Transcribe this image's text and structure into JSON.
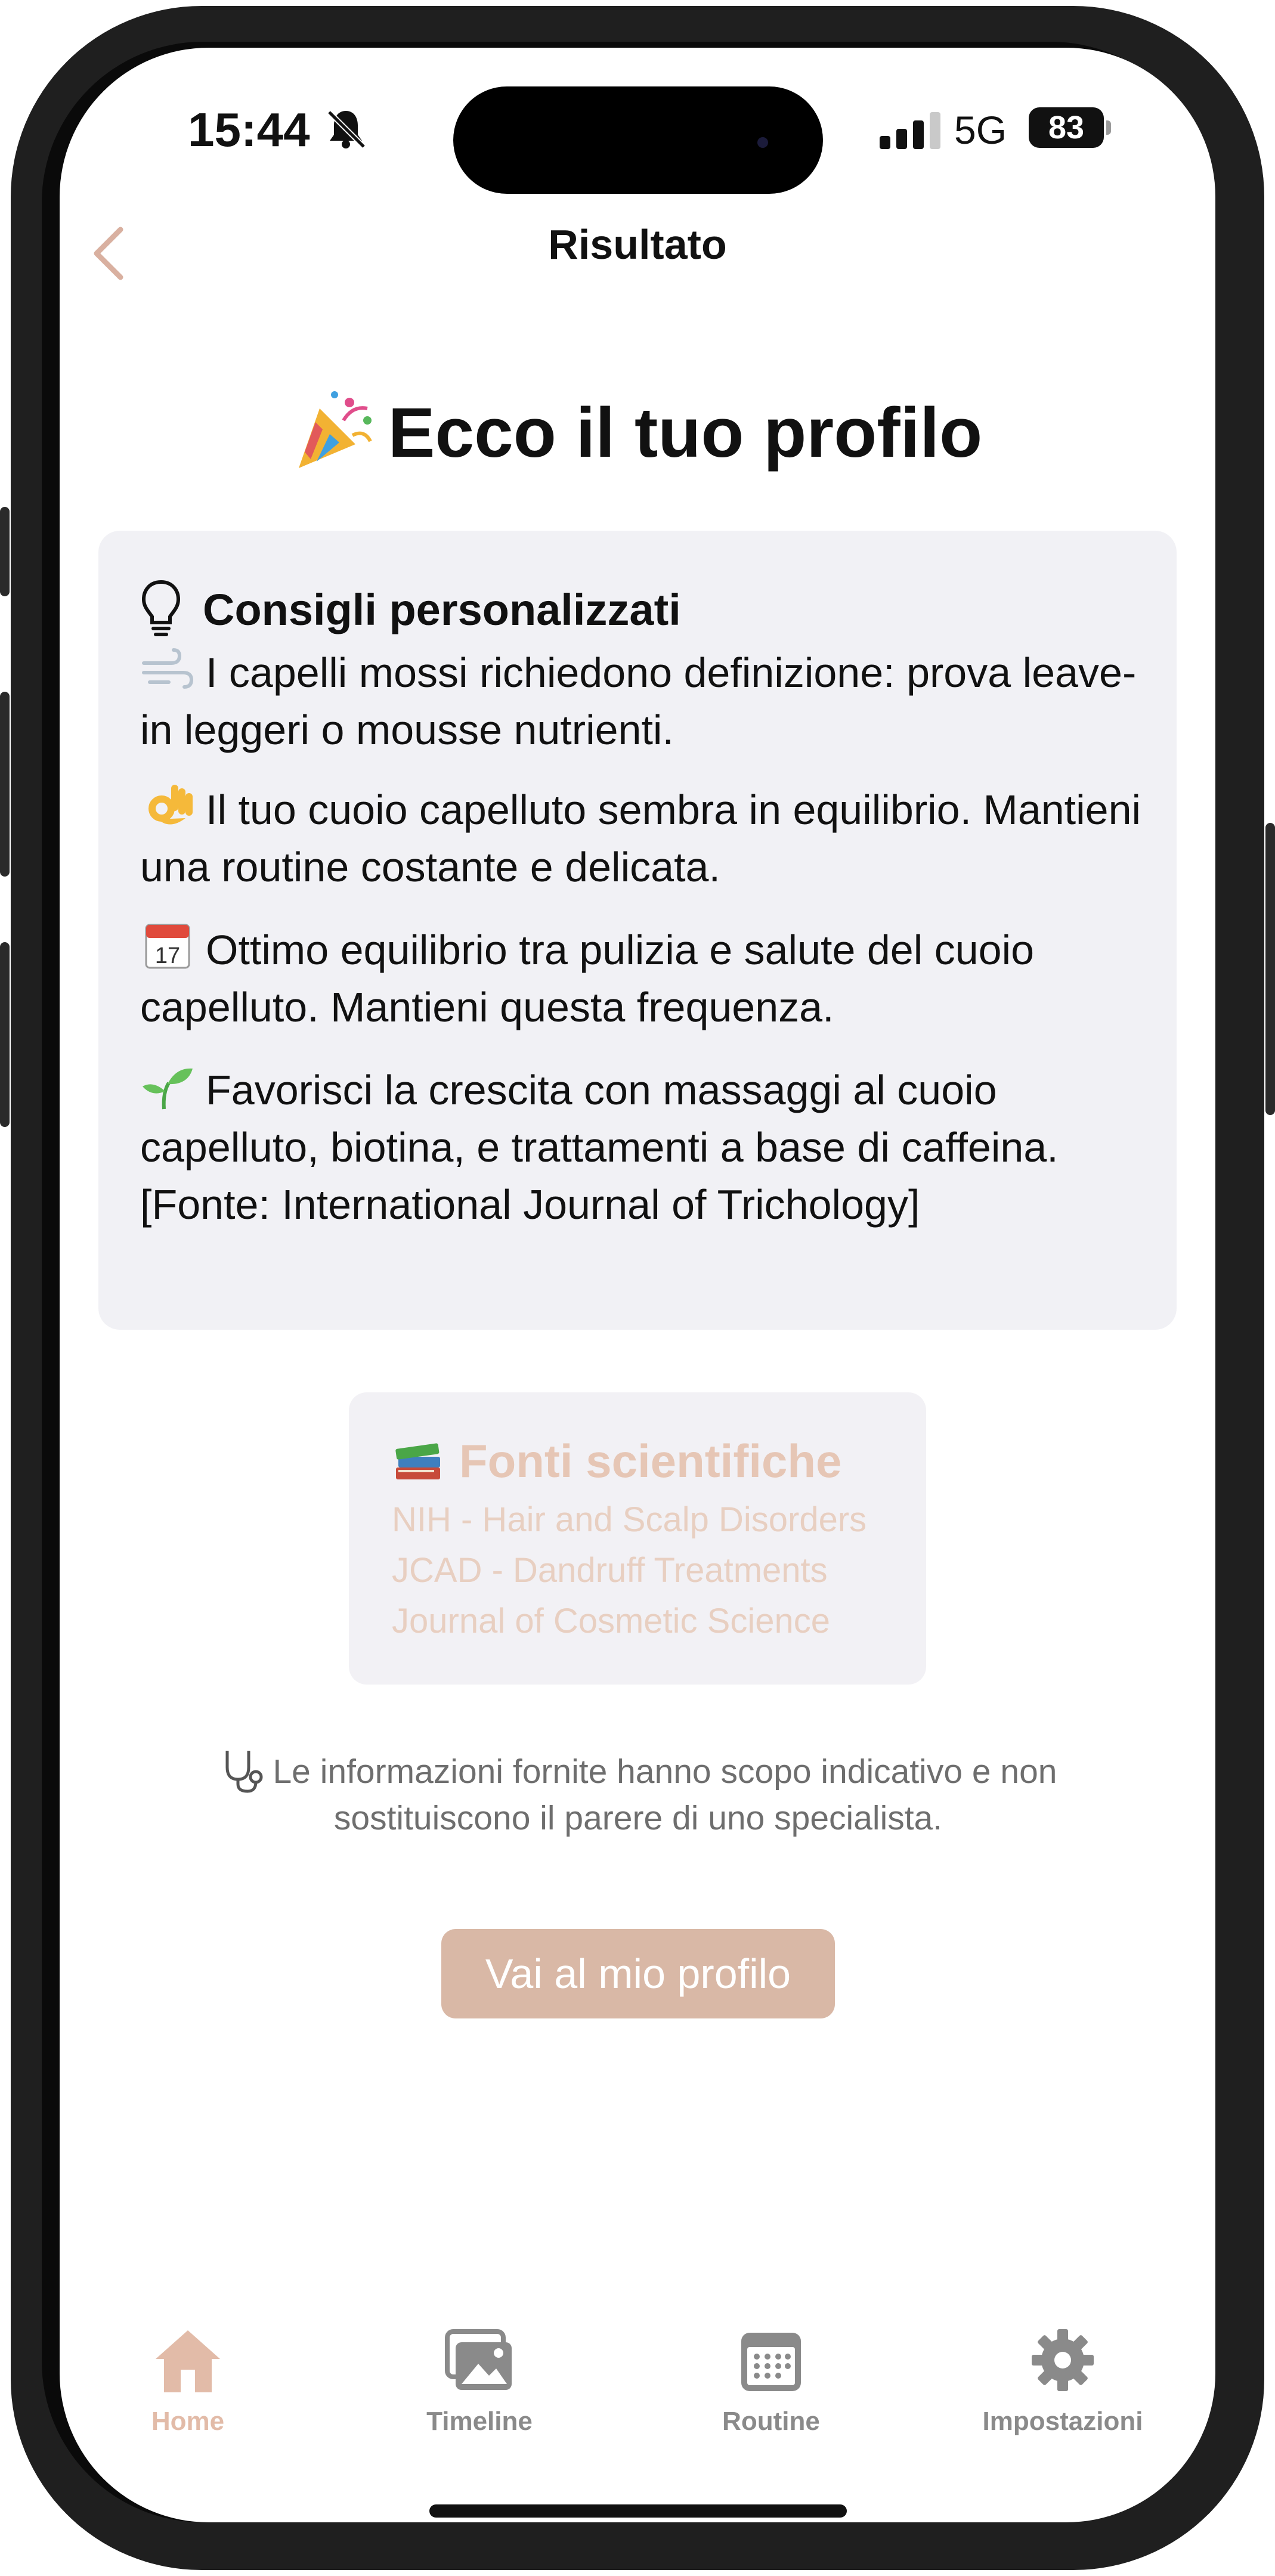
{
  "status_bar": {
    "time": "15:44",
    "network": "5G",
    "battery": "83"
  },
  "nav": {
    "title": "Risultato"
  },
  "headline": "Ecco il tuo profilo",
  "advice": {
    "title": "Consigli personalizzati",
    "tips": [
      {
        "icon": "wind-icon",
        "text": "I capelli mossi richiedono definizione: prova leave-in leggeri o mousse nutrienti."
      },
      {
        "icon": "ok-hand-icon",
        "text": "Il tuo cuoio capelluto sembra in equilibrio. Mantieni una routine costante e delicata."
      },
      {
        "icon": "calendar-icon",
        "text": "Ottimo equilibrio tra pulizia e salute del cuoio capelluto. Mantieni questa frequenza."
      },
      {
        "icon": "seedling-icon",
        "text": "Favorisci la crescita con massaggi al cuoio capelluto, biotina, e trattamenti a base di caffeina. [Fonte: International Journal of Trichology]"
      }
    ],
    "calendar_day": "17"
  },
  "sources": {
    "title": "Fonti scientifiche",
    "items": [
      "NIH - Hair and Scalp Disorders",
      "JCAD - Dandruff Treatments",
      "Journal of Cosmetic Science"
    ]
  },
  "disclaimer": "Le informazioni fornite hanno scopo indicativo e non sostituiscono il parere di uno specialista.",
  "cta": {
    "label": "Vai al mio profilo"
  },
  "tabs": [
    {
      "label": "Home",
      "icon": "home-icon",
      "active": true
    },
    {
      "label": "Timeline",
      "icon": "photos-icon",
      "active": false
    },
    {
      "label": "Routine",
      "icon": "calendar-icon",
      "active": false
    },
    {
      "label": "Impostazioni",
      "icon": "gear-icon",
      "active": false
    }
  ],
  "colors": {
    "accent": "#d9b8a6",
    "accent_light": "#e6c6b5",
    "card_bg": "#f1f1f5",
    "tab_inactive": "#8a8a8a"
  }
}
